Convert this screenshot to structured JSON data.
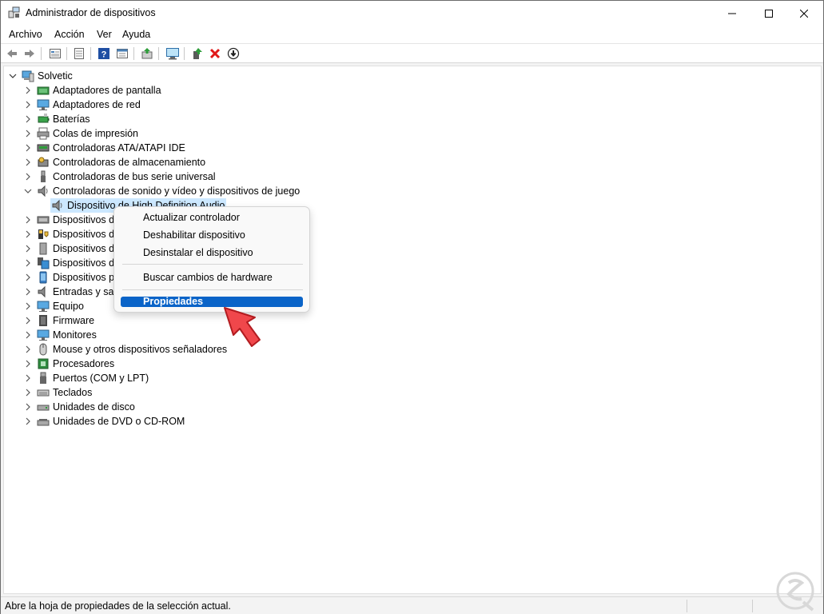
{
  "window": {
    "title": "Administrador de dispositivos",
    "controls": [
      "minimize-icon",
      "maximize-icon",
      "close-icon"
    ]
  },
  "menubar": {
    "items": [
      "Archivo",
      "Acción",
      "Ver",
      "Ayuda"
    ]
  },
  "toolbar": {
    "buttons": [
      "back-icon",
      "forward-icon",
      "properties-view-icon",
      "list-view-icon",
      "help-icon",
      "details-view-icon",
      "update-driver-icon",
      "scan-hardware-icon",
      "add-driver-icon",
      "uninstall-icon",
      "disable-icon"
    ]
  },
  "tree": {
    "root": "Solvetic",
    "categories": [
      {
        "label": "Adaptadores de pantalla",
        "icon": "display-adapter-icon"
      },
      {
        "label": "Adaptadores de red",
        "icon": "network-adapter-icon"
      },
      {
        "label": "Baterías",
        "icon": "battery-icon"
      },
      {
        "label": "Colas de impresión",
        "icon": "printer-icon"
      },
      {
        "label": "Controladoras ATA/ATAPI IDE",
        "icon": "ide-controller-icon"
      },
      {
        "label": "Controladoras de almacenamiento",
        "icon": "storage-controller-icon"
      },
      {
        "label": "Controladoras de bus serie universal",
        "icon": "usb-icon"
      },
      {
        "label": "Controladoras de sonido y vídeo y dispositivos de juego",
        "icon": "speaker-icon"
      },
      {
        "label": "Dispositivo de High Definition Audio",
        "icon": "speaker-icon"
      },
      {
        "label": "Dispositivos de",
        "icon": "hid-icon"
      },
      {
        "label": "Dispositivos de",
        "icon": "security-device-icon"
      },
      {
        "label": "Dispositivos de",
        "icon": "memory-device-icon"
      },
      {
        "label": "Dispositivos de",
        "icon": "software-device-icon"
      },
      {
        "label": "Dispositivos p",
        "icon": "portable-device-icon"
      },
      {
        "label": "Entradas y sali",
        "icon": "audio-io-icon"
      },
      {
        "label": "Equipo",
        "icon": "computer-icon"
      },
      {
        "label": "Firmware",
        "icon": "firmware-icon"
      },
      {
        "label": "Monitores",
        "icon": "monitor-icon"
      },
      {
        "label": "Mouse y otros dispositivos señaladores",
        "icon": "mouse-icon"
      },
      {
        "label": "Procesadores",
        "icon": "cpu-icon"
      },
      {
        "label": "Puertos (COM y LPT)",
        "icon": "port-icon"
      },
      {
        "label": "Teclados",
        "icon": "keyboard-icon"
      },
      {
        "label": "Unidades de disco",
        "icon": "disk-drive-icon"
      },
      {
        "label": "Unidades de DVD o CD-ROM",
        "icon": "dvd-drive-icon"
      }
    ]
  },
  "context_menu": {
    "items": [
      "Actualizar controlador",
      "Deshabilitar dispositivo",
      "Desinstalar el dispositivo",
      "Buscar cambios de hardware",
      "Propiedades"
    ],
    "highlighted": "Propiedades"
  },
  "statusbar": {
    "text": "Abre la hoja de propiedades de la selección actual."
  },
  "colors": {
    "selection": "#cce8ff",
    "highlight": "#0a64c8",
    "arrow": "#f0474b"
  }
}
